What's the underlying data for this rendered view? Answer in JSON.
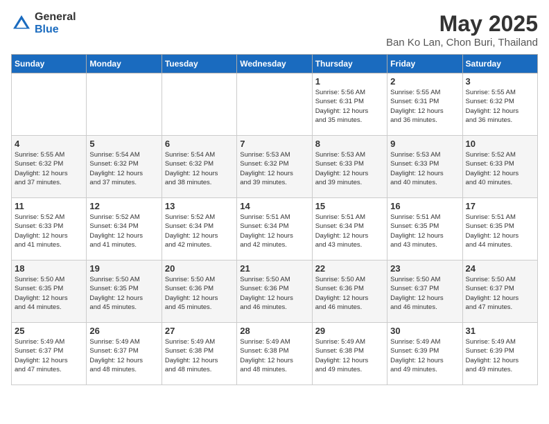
{
  "logo": {
    "general": "General",
    "blue": "Blue"
  },
  "title": "May 2025",
  "subtitle": "Ban Ko Lan, Chon Buri, Thailand",
  "days_of_week": [
    "Sunday",
    "Monday",
    "Tuesday",
    "Wednesday",
    "Thursday",
    "Friday",
    "Saturday"
  ],
  "weeks": [
    [
      {
        "day": "",
        "info": ""
      },
      {
        "day": "",
        "info": ""
      },
      {
        "day": "",
        "info": ""
      },
      {
        "day": "",
        "info": ""
      },
      {
        "day": "1",
        "info": "Sunrise: 5:56 AM\nSunset: 6:31 PM\nDaylight: 12 hours\nand 35 minutes."
      },
      {
        "day": "2",
        "info": "Sunrise: 5:55 AM\nSunset: 6:31 PM\nDaylight: 12 hours\nand 36 minutes."
      },
      {
        "day": "3",
        "info": "Sunrise: 5:55 AM\nSunset: 6:32 PM\nDaylight: 12 hours\nand 36 minutes."
      }
    ],
    [
      {
        "day": "4",
        "info": "Sunrise: 5:55 AM\nSunset: 6:32 PM\nDaylight: 12 hours\nand 37 minutes."
      },
      {
        "day": "5",
        "info": "Sunrise: 5:54 AM\nSunset: 6:32 PM\nDaylight: 12 hours\nand 37 minutes."
      },
      {
        "day": "6",
        "info": "Sunrise: 5:54 AM\nSunset: 6:32 PM\nDaylight: 12 hours\nand 38 minutes."
      },
      {
        "day": "7",
        "info": "Sunrise: 5:53 AM\nSunset: 6:32 PM\nDaylight: 12 hours\nand 39 minutes."
      },
      {
        "day": "8",
        "info": "Sunrise: 5:53 AM\nSunset: 6:33 PM\nDaylight: 12 hours\nand 39 minutes."
      },
      {
        "day": "9",
        "info": "Sunrise: 5:53 AM\nSunset: 6:33 PM\nDaylight: 12 hours\nand 40 minutes."
      },
      {
        "day": "10",
        "info": "Sunrise: 5:52 AM\nSunset: 6:33 PM\nDaylight: 12 hours\nand 40 minutes."
      }
    ],
    [
      {
        "day": "11",
        "info": "Sunrise: 5:52 AM\nSunset: 6:33 PM\nDaylight: 12 hours\nand 41 minutes."
      },
      {
        "day": "12",
        "info": "Sunrise: 5:52 AM\nSunset: 6:34 PM\nDaylight: 12 hours\nand 41 minutes."
      },
      {
        "day": "13",
        "info": "Sunrise: 5:52 AM\nSunset: 6:34 PM\nDaylight: 12 hours\nand 42 minutes."
      },
      {
        "day": "14",
        "info": "Sunrise: 5:51 AM\nSunset: 6:34 PM\nDaylight: 12 hours\nand 42 minutes."
      },
      {
        "day": "15",
        "info": "Sunrise: 5:51 AM\nSunset: 6:34 PM\nDaylight: 12 hours\nand 43 minutes."
      },
      {
        "day": "16",
        "info": "Sunrise: 5:51 AM\nSunset: 6:35 PM\nDaylight: 12 hours\nand 43 minutes."
      },
      {
        "day": "17",
        "info": "Sunrise: 5:51 AM\nSunset: 6:35 PM\nDaylight: 12 hours\nand 44 minutes."
      }
    ],
    [
      {
        "day": "18",
        "info": "Sunrise: 5:50 AM\nSunset: 6:35 PM\nDaylight: 12 hours\nand 44 minutes."
      },
      {
        "day": "19",
        "info": "Sunrise: 5:50 AM\nSunset: 6:35 PM\nDaylight: 12 hours\nand 45 minutes."
      },
      {
        "day": "20",
        "info": "Sunrise: 5:50 AM\nSunset: 6:36 PM\nDaylight: 12 hours\nand 45 minutes."
      },
      {
        "day": "21",
        "info": "Sunrise: 5:50 AM\nSunset: 6:36 PM\nDaylight: 12 hours\nand 46 minutes."
      },
      {
        "day": "22",
        "info": "Sunrise: 5:50 AM\nSunset: 6:36 PM\nDaylight: 12 hours\nand 46 minutes."
      },
      {
        "day": "23",
        "info": "Sunrise: 5:50 AM\nSunset: 6:37 PM\nDaylight: 12 hours\nand 46 minutes."
      },
      {
        "day": "24",
        "info": "Sunrise: 5:50 AM\nSunset: 6:37 PM\nDaylight: 12 hours\nand 47 minutes."
      }
    ],
    [
      {
        "day": "25",
        "info": "Sunrise: 5:49 AM\nSunset: 6:37 PM\nDaylight: 12 hours\nand 47 minutes."
      },
      {
        "day": "26",
        "info": "Sunrise: 5:49 AM\nSunset: 6:37 PM\nDaylight: 12 hours\nand 48 minutes."
      },
      {
        "day": "27",
        "info": "Sunrise: 5:49 AM\nSunset: 6:38 PM\nDaylight: 12 hours\nand 48 minutes."
      },
      {
        "day": "28",
        "info": "Sunrise: 5:49 AM\nSunset: 6:38 PM\nDaylight: 12 hours\nand 48 minutes."
      },
      {
        "day": "29",
        "info": "Sunrise: 5:49 AM\nSunset: 6:38 PM\nDaylight: 12 hours\nand 49 minutes."
      },
      {
        "day": "30",
        "info": "Sunrise: 5:49 AM\nSunset: 6:39 PM\nDaylight: 12 hours\nand 49 minutes."
      },
      {
        "day": "31",
        "info": "Sunrise: 5:49 AM\nSunset: 6:39 PM\nDaylight: 12 hours\nand 49 minutes."
      }
    ]
  ]
}
